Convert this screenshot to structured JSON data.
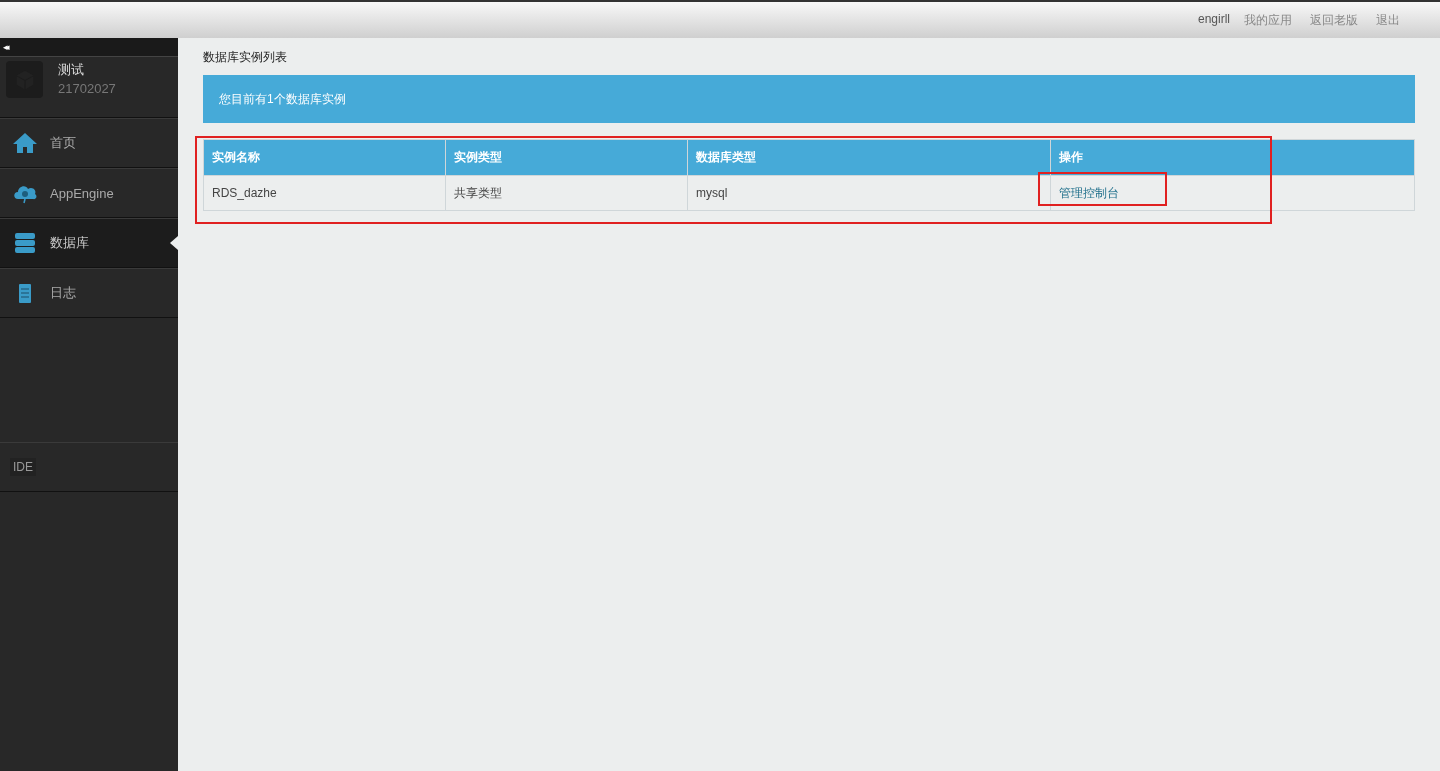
{
  "top_bar": {
    "links": [
      {
        "label": "engirll",
        "kind": "user"
      },
      {
        "label": "我的应用",
        "kind": "link"
      },
      {
        "label": "返回老版",
        "kind": "link"
      },
      {
        "label": "退出",
        "kind": "link"
      }
    ]
  },
  "sidebar": {
    "collapse_glyph": "◂◂",
    "profile": {
      "name": "测试",
      "id": "21702027"
    },
    "items": [
      {
        "label": "首页",
        "kind": "home",
        "selected": false
      },
      {
        "label": "AppEngine",
        "kind": "engine",
        "selected": false
      },
      {
        "label": "数据库",
        "kind": "database",
        "selected": true
      },
      {
        "label": "日志",
        "kind": "log",
        "selected": false
      }
    ],
    "tool": {
      "label": "IDE"
    }
  },
  "page_title": "数据库实例列表",
  "banner": "您目前有1个数据库实例",
  "table": {
    "columns": [
      "实例名称",
      "实例类型",
      "数据库类型",
      "操作"
    ],
    "rows": [
      {
        "cells": [
          "RDS_dazhe",
          "共享类型",
          "mysql"
        ],
        "action": "管理控制台"
      }
    ]
  }
}
